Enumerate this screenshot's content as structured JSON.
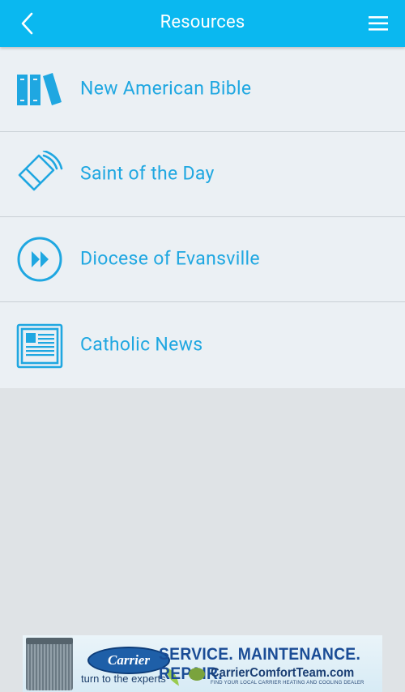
{
  "header": {
    "title": "Resources",
    "back_icon": "chevron-left-icon",
    "menu_icon": "hamburger-menu-icon"
  },
  "resources": [
    {
      "label": "New American Bible",
      "icon": "books-icon"
    },
    {
      "label": "Saint of the Day",
      "icon": "megaphone-icon"
    },
    {
      "label": "Diocese of Evansville",
      "icon": "fast-forward-circle-icon"
    },
    {
      "label": "Catholic News",
      "icon": "newspaper-icon"
    }
  ],
  "ad": {
    "brand": "Carrier",
    "tagline": "turn to the experts",
    "headline": "SERVICE. MAINTENANCE. REPAIR.",
    "url": "CarrierComfortTeam.com",
    "subline": "FIND YOUR LOCAL CARRIER HEATING AND COOLING DEALER"
  },
  "colors": {
    "header_bg": "#0ab8f0",
    "accent": "#1fa7e1",
    "list_bg": "#ebf0f4",
    "page_bg": "#dfe3e6"
  }
}
